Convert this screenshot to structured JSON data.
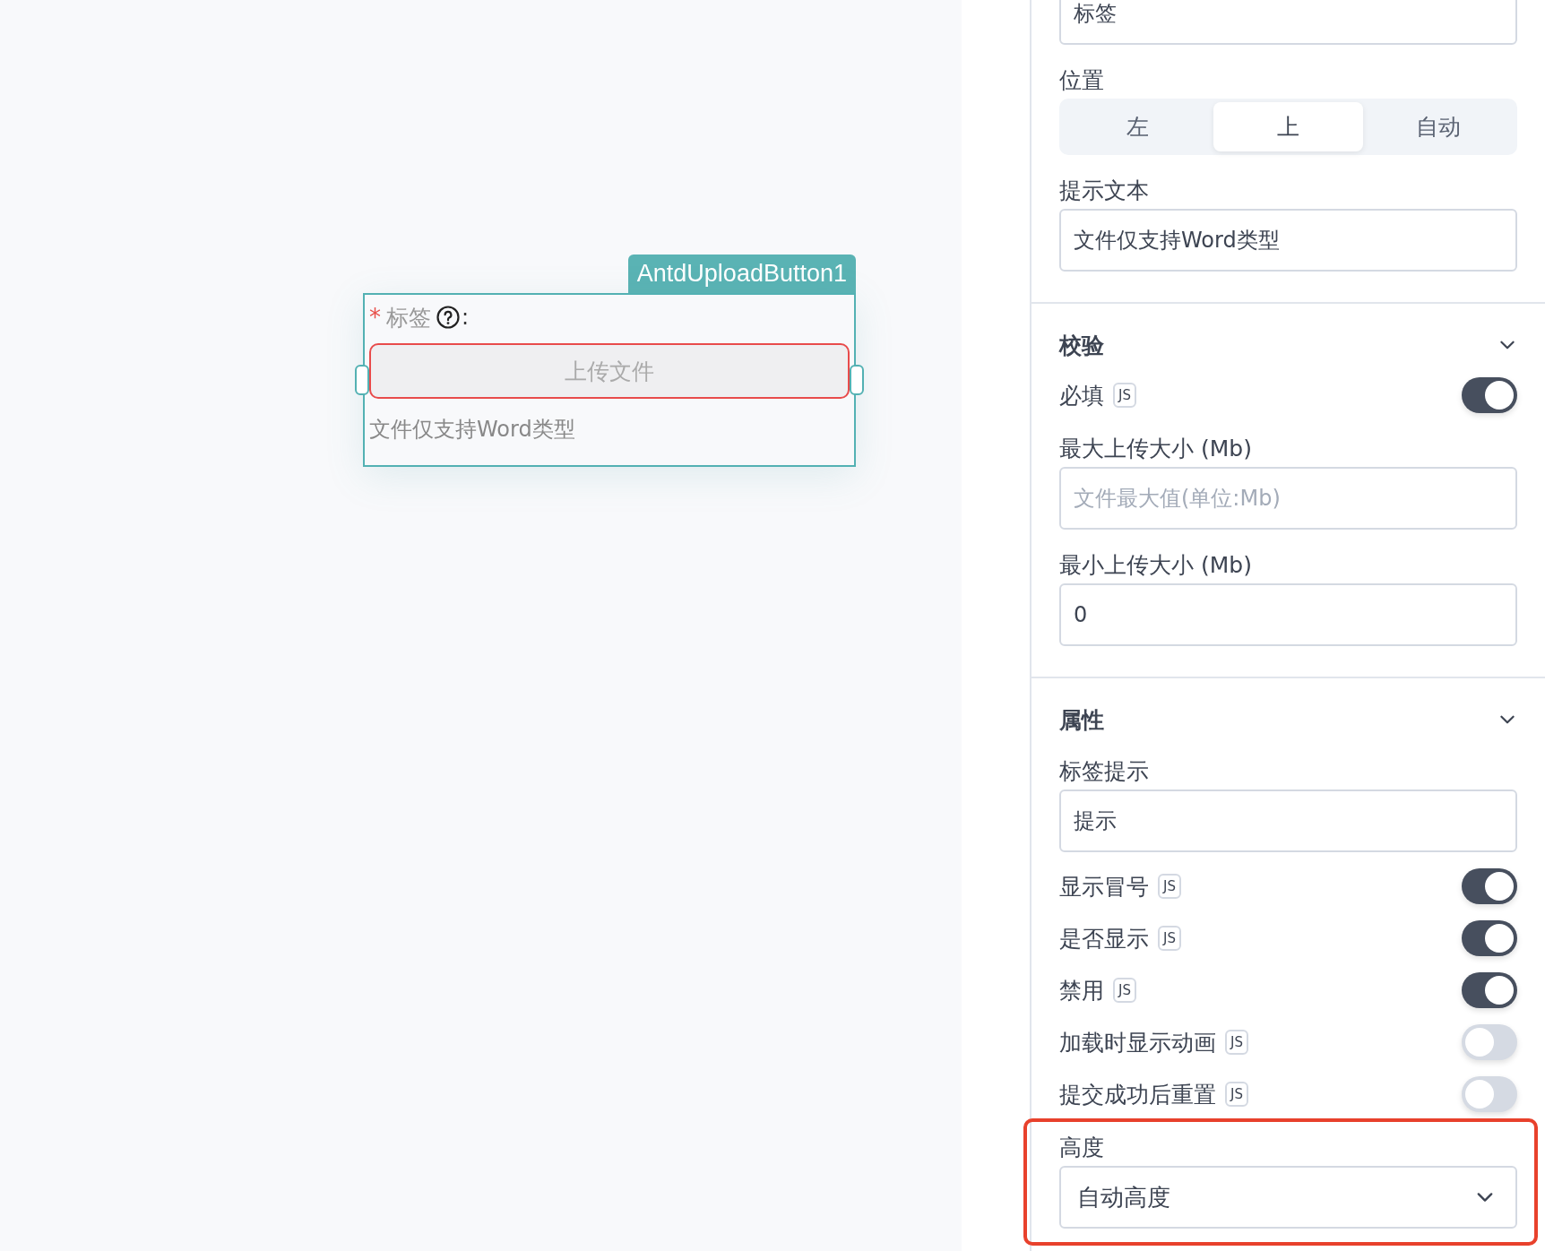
{
  "canvas": {
    "component": {
      "tag": "AntdUploadButton1",
      "selected": true,
      "required_mark": "*",
      "label": "标签",
      "colon": ":",
      "button": "上传文件",
      "invalid": true,
      "help_text": "文件仅支持Word类型"
    }
  },
  "panel": {
    "sections": [
      {
        "items": [
          {
            "kind": "input",
            "value": "标签"
          },
          {
            "kind": "segmented",
            "label": "位置",
            "options": [
              {
                "label": "左",
                "selected": false
              },
              {
                "label": "上",
                "selected": true
              },
              {
                "label": "自动",
                "selected": false
              }
            ]
          },
          {
            "kind": "input",
            "label": "提示文本",
            "value": "文件仅支持Word类型"
          }
        ]
      },
      {
        "title": "校验",
        "expanded": true,
        "items": [
          {
            "kind": "toggle",
            "label": "必填",
            "badge": "JS",
            "on": true
          },
          {
            "kind": "input",
            "label": "最大上传大小 (Mb)",
            "placeholder": "文件最大值(单位:Mb)"
          },
          {
            "kind": "input",
            "label": "最小上传大小 (Mb)",
            "value": "0"
          }
        ]
      },
      {
        "title": "属性",
        "expanded": true,
        "items": [
          {
            "kind": "input",
            "label": "标签提示",
            "value": "提示"
          },
          {
            "kind": "toggle",
            "label": "显示冒号",
            "badge": "JS",
            "on": true
          },
          {
            "kind": "toggle",
            "label": "是否显示",
            "badge": "JS",
            "on": true
          },
          {
            "kind": "toggle",
            "label": "禁用",
            "badge": "JS",
            "on": true
          },
          {
            "kind": "toggle",
            "label": "加载时显示动画",
            "badge": "JS",
            "on": false
          },
          {
            "kind": "toggle",
            "label": "提交成功后重置",
            "badge": "JS",
            "on": false
          },
          {
            "kind": "select",
            "label": "高度",
            "value": "自动高度",
            "highlighted": true
          }
        ]
      }
    ]
  }
}
